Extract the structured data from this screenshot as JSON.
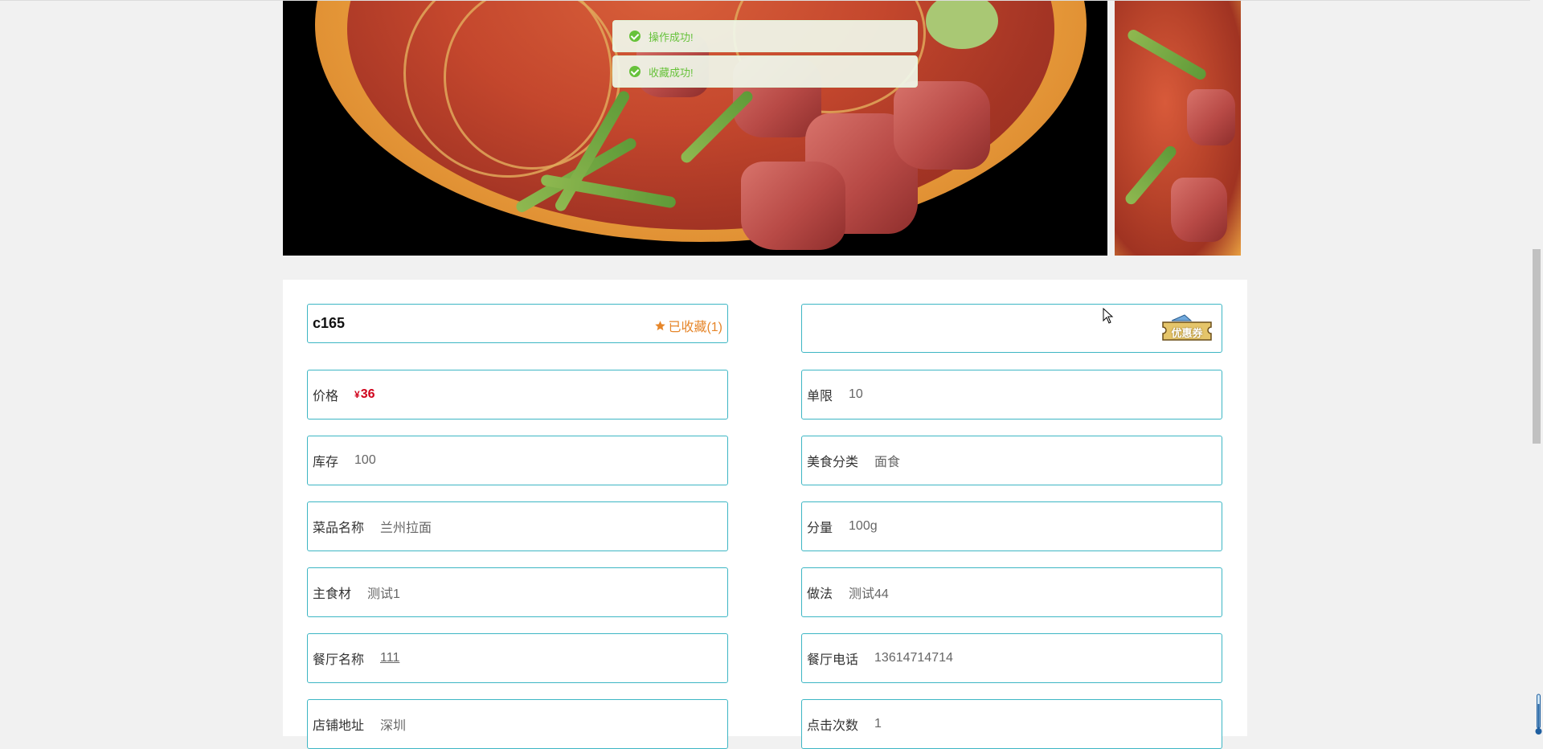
{
  "toasts": [
    {
      "message": "操作成功!"
    },
    {
      "message": "收藏成功!"
    }
  ],
  "detail": {
    "title": "c165",
    "favorite_label": "已收藏(1)",
    "coupon_label": "优惠券",
    "fields": {
      "price": {
        "label": "价格",
        "currency": "¥",
        "value": "36"
      },
      "limit": {
        "label": "单限",
        "value": "10"
      },
      "stock": {
        "label": "库存",
        "value": "100"
      },
      "category": {
        "label": "美食分类",
        "value": "面食"
      },
      "dish_name": {
        "label": "菜品名称",
        "value": "兰州拉面"
      },
      "portion": {
        "label": "分量",
        "value": "100g"
      },
      "main_ingredient": {
        "label": "主食材",
        "value": "测试1"
      },
      "method": {
        "label": "做法",
        "value": "测试44"
      },
      "restaurant_name": {
        "label": "餐厅名称",
        "value": "111"
      },
      "restaurant_phone": {
        "label": "餐厅电话",
        "value": "13614714714"
      },
      "address": {
        "label": "店铺地址",
        "value": "深圳"
      },
      "clicks": {
        "label": "点击次数",
        "value": "1"
      }
    }
  },
  "colors": {
    "field_border": "#3db6c4",
    "price": "#d0021b",
    "favorite": "#e6862a",
    "toast_text": "#67c23a"
  },
  "icons": {
    "toast": "success-check-icon",
    "favorite": "star-icon",
    "coupon": "coupon-ticket-icon"
  }
}
